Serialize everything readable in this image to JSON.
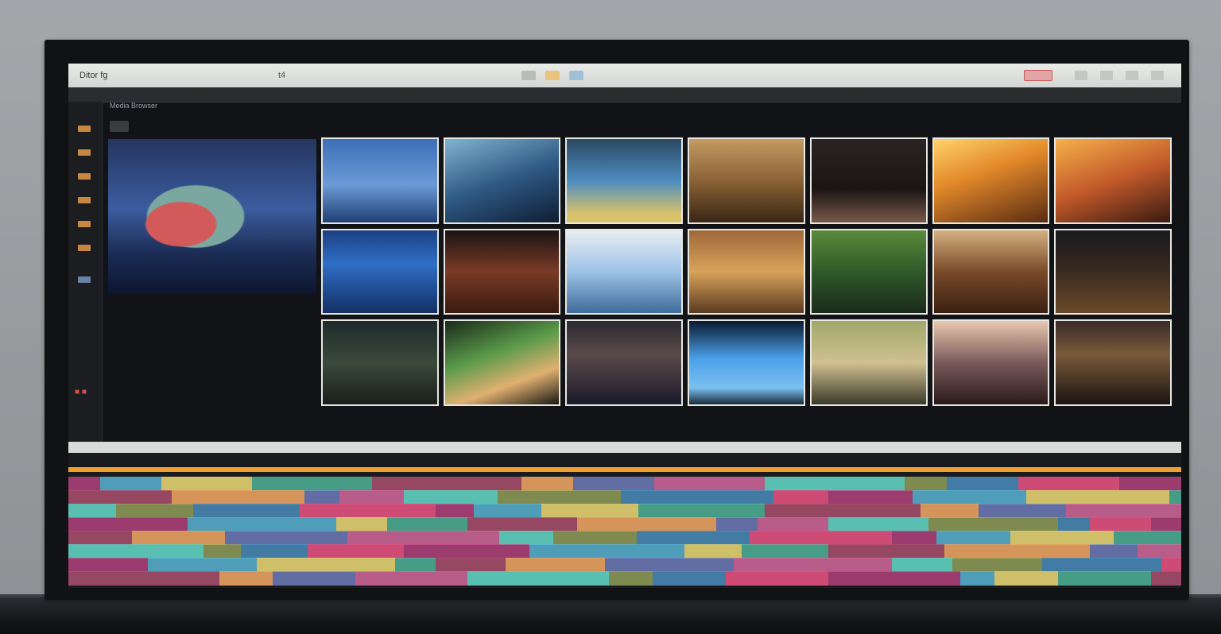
{
  "menubar": {
    "title": "Ditor fg",
    "center": "t4"
  },
  "panel": {
    "label": "Media Browser",
    "tab_label": ""
  },
  "viewer": {
    "clip_title": "",
    "clip_desc": "",
    "clip_link": "",
    "meta": ""
  },
  "timeline": {
    "ruler": ""
  },
  "colors": {
    "accent": "#f0a030",
    "record": "#d05050",
    "menubar_bg": "#dfe2de"
  },
  "icons": [
    "window-icon",
    "pen-icon",
    "folder-icon",
    "video-icon",
    "record-icon",
    "minimize-icon",
    "maximize-icon",
    "close-icon"
  ],
  "grid": {
    "thumbs": [
      {
        "caption": ""
      },
      {
        "caption": ""
      },
      {
        "caption": ""
      },
      {
        "caption": ""
      },
      {
        "caption": ""
      },
      {
        "caption": ""
      },
      {
        "caption": ""
      },
      {
        "caption": ""
      },
      {
        "caption": ""
      },
      {
        "caption": ""
      },
      {
        "caption": ""
      },
      {
        "caption": ""
      },
      {
        "caption": ""
      },
      {
        "caption": ""
      },
      {
        "caption": ""
      },
      {
        "caption": ""
      },
      {
        "caption": ""
      },
      {
        "caption": ""
      },
      {
        "caption": ""
      },
      {
        "caption": ""
      },
      {
        "caption": ""
      }
    ]
  }
}
